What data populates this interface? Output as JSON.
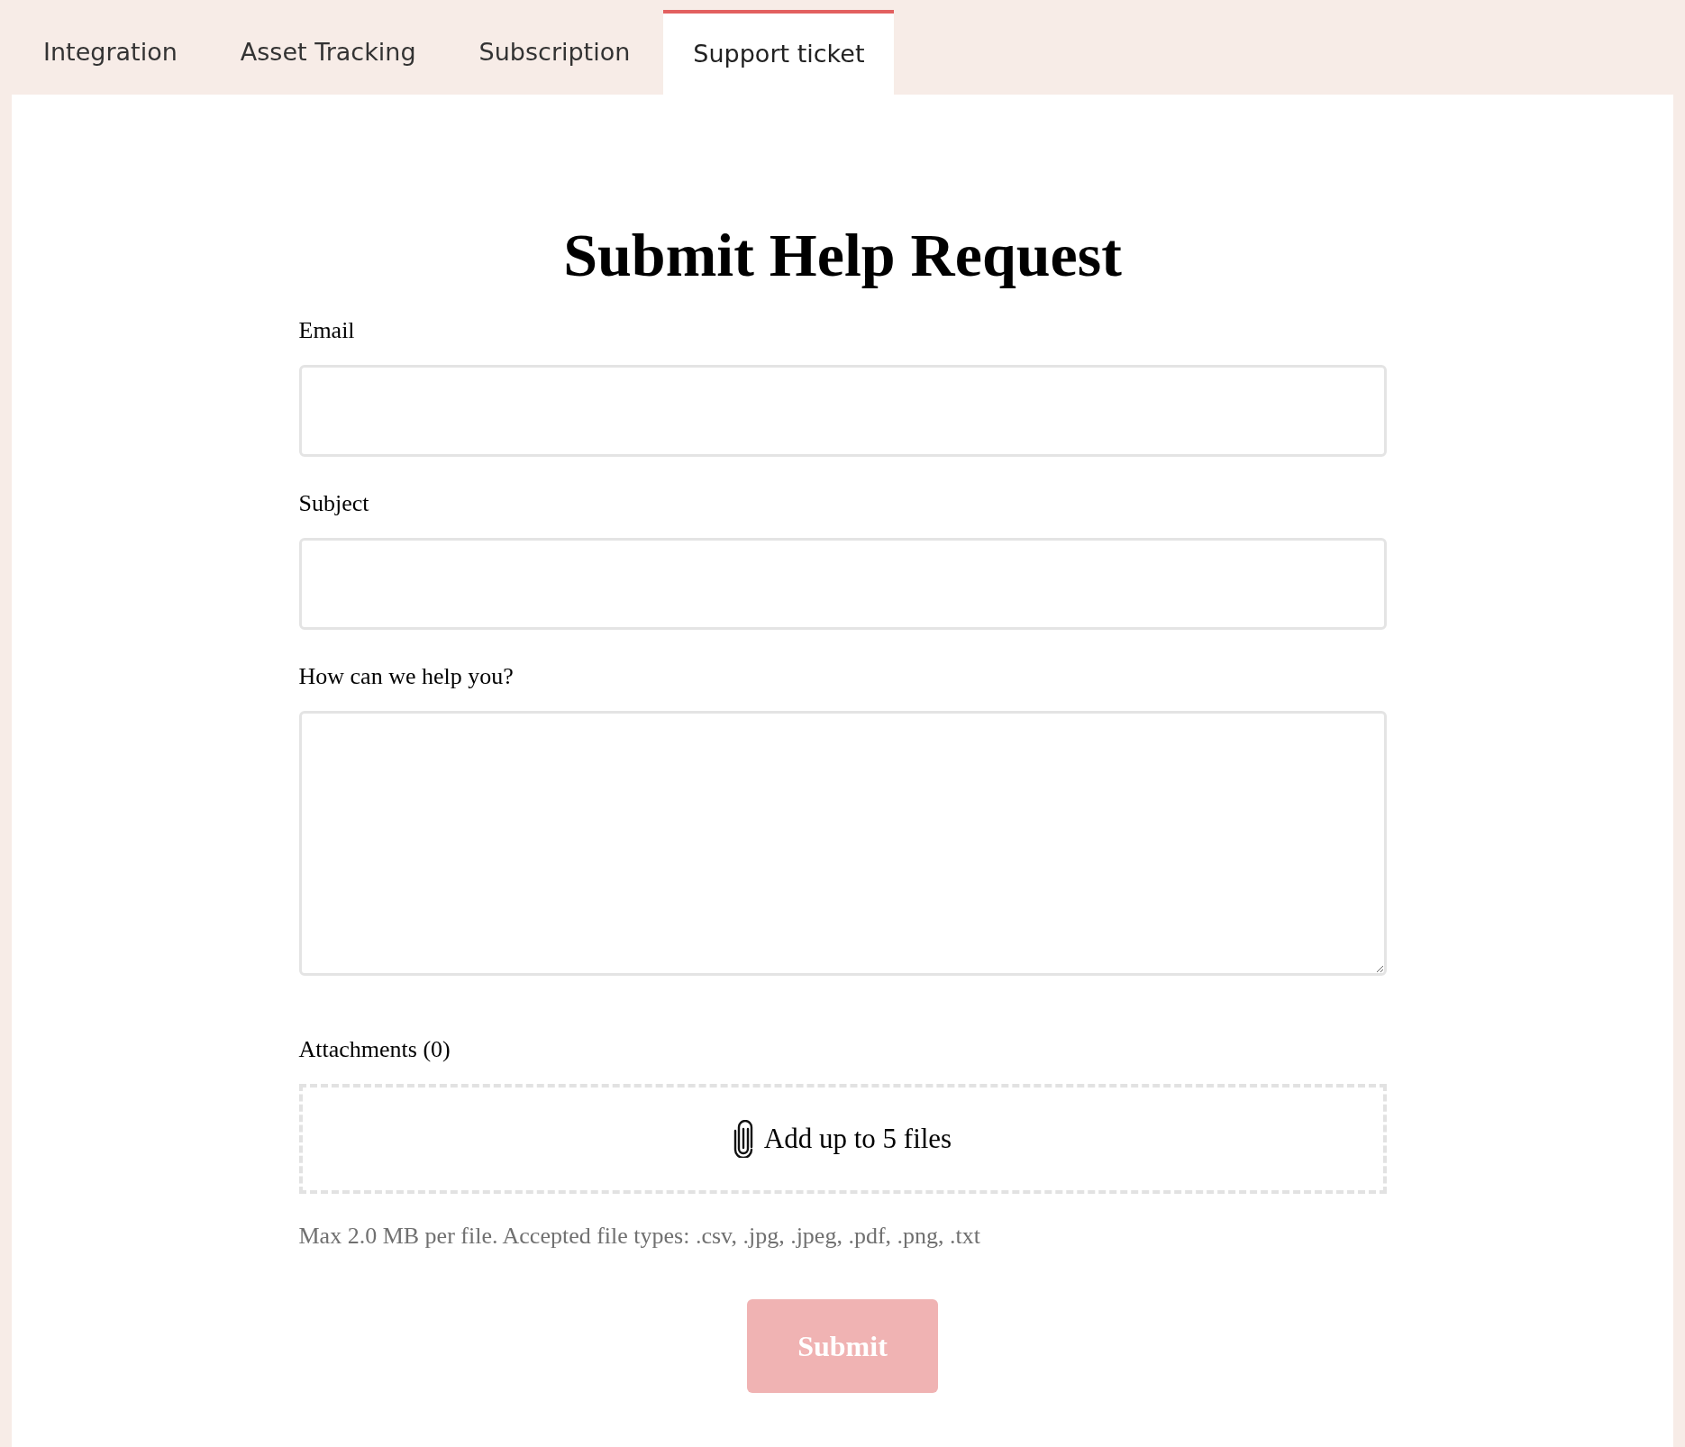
{
  "tabs": [
    {
      "label": "Integration",
      "selected": false
    },
    {
      "label": "Asset Tracking",
      "selected": false
    },
    {
      "label": "Subscription",
      "selected": false
    },
    {
      "label": "Support ticket",
      "selected": true
    }
  ],
  "title": "Submit Help Request",
  "fields": [
    {
      "label": "Email",
      "kind": "input"
    },
    {
      "label": "Subject",
      "kind": "input"
    },
    {
      "label": "How can we help you?",
      "kind": "textarea"
    }
  ],
  "attachments": {
    "label": "Attachments (0)",
    "dropzone": "Add up to 5 files",
    "note": "Max 2.0 MB per file. Accepted file types: .csv, .jpg, .jpeg, .pdf, .png, .txt"
  },
  "submit": {
    "label": "Submit",
    "disabled": true
  }
}
